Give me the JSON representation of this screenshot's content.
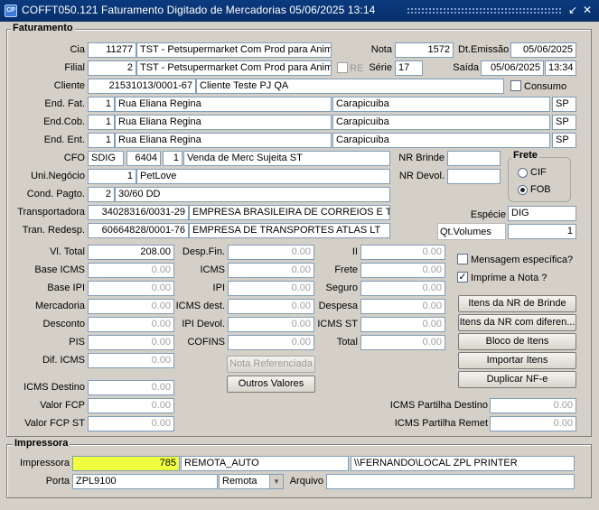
{
  "window": {
    "title": "COFFT050.121   Faturamento Digitado de Mercadorias   05/06/2025 13:14",
    "icon": "CP",
    "restore_glyph": "↙",
    "close_glyph": "✕"
  },
  "faturamento": {
    "section_title": "Faturamento",
    "cia": {
      "label": "Cia",
      "code": "11277",
      "name": "TST - Petsupermarket Com Prod para Anima"
    },
    "filial": {
      "label": "Filial",
      "code": "2",
      "name": "TST - Petsupermarket Com Prod para Anima",
      "re_label": "RE"
    },
    "nota": {
      "label": "Nota",
      "value": "1572"
    },
    "dt_emissao": {
      "label": "Dt.Emissão",
      "value": "05/06/2025"
    },
    "serie": {
      "label": "Série",
      "value": "17"
    },
    "saida": {
      "label": "Saída",
      "date": "05/06/2025",
      "time": "13:34"
    },
    "cliente": {
      "label": "Cliente",
      "code": "21531013/0001-67",
      "name": "Cliente Teste PJ QA",
      "consumo_label": "Consumo"
    },
    "end_fat": {
      "label": "End. Fat.",
      "num": "1",
      "street": "Rua Eliana Regina",
      "city": "Carapicuiba",
      "uf": "SP"
    },
    "end_cob": {
      "label": "End.Cob.",
      "num": "1",
      "street": "Rua Eliana Regina",
      "city": "Carapicuiba",
      "uf": "SP"
    },
    "end_ent": {
      "label": "End. Ent.",
      "num": "1",
      "street": "Rua Eliana Regina",
      "city": "Carapicuiba",
      "uf": "SP"
    },
    "cfo": {
      "label": "CFO",
      "sigla": "SDIG",
      "code": "6404",
      "seq": "1",
      "desc": "Venda de Merc Sujeita ST"
    },
    "nr_brinde": {
      "label": "NR Brinde",
      "value": ""
    },
    "nr_devol": {
      "label": "NR Devol.",
      "value": ""
    },
    "frete": {
      "label": "Frete",
      "cif_label": "CIF",
      "fob_label": "FOB",
      "selected": "FOB"
    },
    "uni_negocio": {
      "label": "Uni.Negócio",
      "code": "1",
      "name": "PetLove"
    },
    "cond_pagto": {
      "label": "Cond. Pagto.",
      "code": "2",
      "desc": "30/60 DD"
    },
    "transportadora": {
      "label": "Transportadora",
      "cnpj": "34028316/0031-29",
      "name": "EMPRESA BRASILEIRA DE CORREIOS E TELE"
    },
    "tran_redesp": {
      "label": "Tran. Redesp.",
      "cnpj": "60664828/0001-76",
      "name": "EMPRESA DE TRANSPORTES ATLAS LT"
    },
    "especie": {
      "label": "Espécie",
      "value": "DIG"
    },
    "qt_volumes": {
      "label": "Qt.Volumes",
      "value": "1"
    },
    "totals_col1": [
      {
        "label": "Vl. Total",
        "value": "208.00",
        "enabled": true
      },
      {
        "label": "Base ICMS",
        "value": "0.00",
        "enabled": false
      },
      {
        "label": "Base IPI",
        "value": "0.00",
        "enabled": false
      },
      {
        "label": "Mercadoria",
        "value": "0.00",
        "enabled": false
      },
      {
        "label": "Desconto",
        "value": "0.00",
        "enabled": false
      },
      {
        "label": "PIS",
        "value": "0.00",
        "enabled": false
      },
      {
        "label": "Dif. ICMS",
        "value": "0.00",
        "enabled": false
      }
    ],
    "totals_col2": [
      {
        "label": "Desp.Fin.",
        "value": "0.00"
      },
      {
        "label": "ICMS",
        "value": "0.00"
      },
      {
        "label": "IPI",
        "value": "0.00"
      },
      {
        "label": "ICMS dest.",
        "value": "0.00"
      },
      {
        "label": "IPI Devol.",
        "value": "0.00"
      },
      {
        "label": "COFINS",
        "value": "0.00"
      }
    ],
    "totals_col3": [
      {
        "label": "II",
        "value": "0.00"
      },
      {
        "label": "Frete",
        "value": "0.00"
      },
      {
        "label": "Seguro",
        "value": "0.00"
      },
      {
        "label": "Despesa",
        "value": "0.00"
      },
      {
        "label": "ICMS ST",
        "value": "0.00"
      },
      {
        "label": "Total",
        "value": "0.00"
      }
    ],
    "mensagem_especifica": {
      "label": "Mensagem específica?",
      "checked": false
    },
    "imprime_nota": {
      "label": "Imprime a Nota ?",
      "checked": true
    },
    "buttons": {
      "itens_nr_brinde": "Itens da NR de Brinde",
      "itens_nr_diferen": "Itens da NR com diferen...",
      "bloco_itens": "Bloco de Itens",
      "importar_itens": "Importar Itens",
      "duplicar_nfe": "Duplicar NF-e",
      "nota_referenciada": "Nota Referenciada",
      "outros_valores": "Outros Valores"
    },
    "icms_destino": {
      "label": "ICMS Destino",
      "value": "0.00"
    },
    "valor_fcp": {
      "label": "Valor FCP",
      "value": "0.00"
    },
    "valor_fcp_st": {
      "label": "Valor FCP ST",
      "value": "0.00"
    },
    "icms_partilha_destino": {
      "label": "ICMS Partilha Destino",
      "value": "0.00"
    },
    "icms_partilha_remet": {
      "label": "ICMS Partilha Remet",
      "value": "0.00"
    }
  },
  "impressora": {
    "section_title": "Impressora",
    "impressora": {
      "label": "Impressora",
      "code": "785",
      "name": "REMOTA_AUTO",
      "path": "\\\\FERNANDO\\LOCAL ZPL PRINTER"
    },
    "porta": {
      "label": "Porta",
      "value": "ZPL9100",
      "mode": "Remota"
    },
    "arquivo": {
      "label": "Arquivo",
      "value": ""
    }
  },
  "colors": {
    "titlebar": "#0b3a7e",
    "highlight_field": "#f0ff40",
    "background": "#d4d0c8"
  }
}
